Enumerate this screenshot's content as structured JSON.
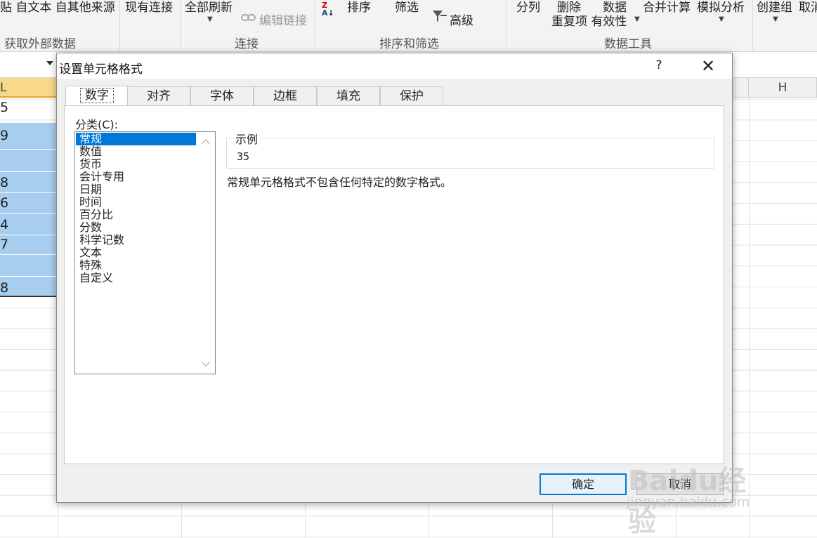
{
  "ribbon": {
    "items_row1": [
      "贴 自文本 自其他来源",
      "现有连接",
      "全部刷新",
      "排序",
      "筛选",
      "分列",
      "删除",
      "数据",
      "合并计算",
      "模拟分析",
      "创建组",
      "取消"
    ],
    "edit_links": "编辑链接",
    "advanced": "高级",
    "row2_data_tools": "重复项 有效性",
    "groups": [
      "获取外部数据",
      "连接",
      "排序和筛选",
      "数据工具"
    ]
  },
  "sheet": {
    "column_h": "H",
    "col_a_header": "L",
    "cells": [
      "5",
      "9",
      "",
      "8",
      "6",
      "4",
      "7",
      "",
      "8"
    ]
  },
  "dialog": {
    "title": "设置单元格格式",
    "help": "?",
    "close": "✕",
    "tabs": [
      "数字",
      "对齐",
      "字体",
      "边框",
      "填充",
      "保护"
    ],
    "category_label": "分类(C):",
    "categories": [
      "常规",
      "数值",
      "货币",
      "会计专用",
      "日期",
      "时间",
      "百分比",
      "分数",
      "科学记数",
      "文本",
      "特殊",
      "自定义"
    ],
    "selected_category": "常规",
    "sample_label": "示例",
    "sample_value": "35",
    "description": "常规单元格格式不包含任何特定的数字格式。",
    "ok": "确定",
    "cancel": "取消"
  },
  "watermark": {
    "brand": "Baidu经验",
    "url": "jingyan.baidu.com"
  }
}
